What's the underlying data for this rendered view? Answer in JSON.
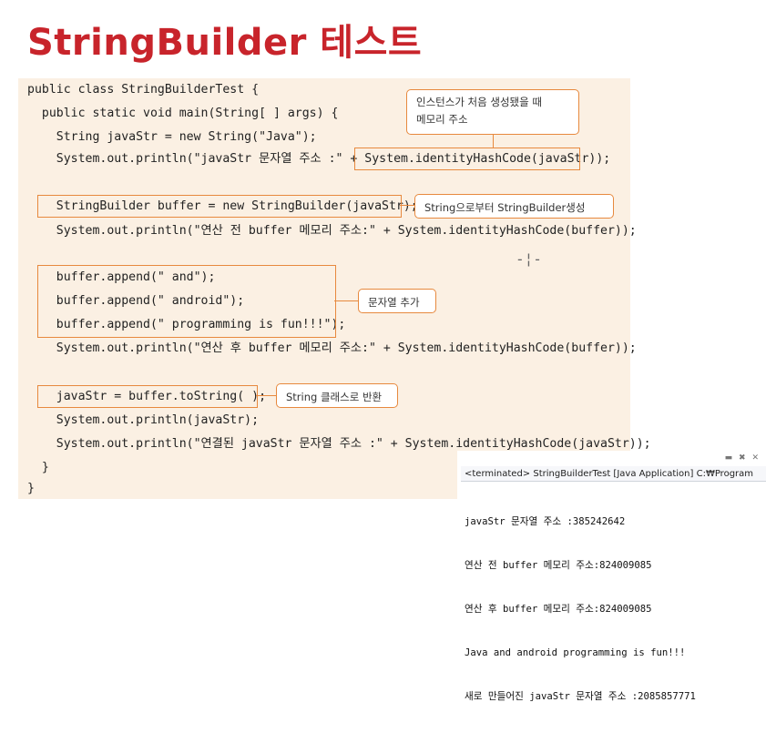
{
  "title": "StringBuilder 테스트",
  "code": {
    "line1": "public class StringBuilderTest {",
    "line2": "  public static void main(String[ ] args) {",
    "line3": "    String javaStr = new String(\"Java\");",
    "line4": "    System.out.println(\"javaStr 문자열 주소 :\" + System.identityHashCode(javaStr));",
    "line5": "    StringBuilder buffer = new StringBuilder(javaStr);",
    "line6": "    System.out.println(\"연산 전 buffer 메모리 주소:\" + System.identityHashCode(buffer));",
    "line7": "    buffer.append(\" and\");",
    "line8": "    buffer.append(\" android\");",
    "line9": "    buffer.append(\" programming is fun!!!\");",
    "line10": "    System.out.println(\"연산 후 buffer 메모리 주소:\" + System.identityHashCode(buffer));",
    "line11": "    javaStr = buffer.toString( );",
    "line12": "    System.out.println(javaStr);",
    "line13": "    System.out.println(\"연결된 javaStr 문자열 주소 :\" + System.identityHashCode(javaStr));",
    "line14": "  }",
    "line15": "}"
  },
  "callouts": {
    "memory_line1": "인스턴스가 처음 생성됐을 때",
    "memory_line2": "메모리 주소",
    "create_builder": "String으로부터 StringBuilder생성",
    "append_string": "문자열 추가",
    "to_string": "String 클래스로 반환"
  },
  "console": {
    "header": "<terminated> StringBuilderTest [Java Application] C:₩Program",
    "toolbar_icons": "minimize-icon, close-icon, remove-icon",
    "output": [
      "javaStr 문자열 주소 :385242642",
      "연산 전 buffer 메모리 주소:824009085",
      "연산 후 buffer 메모리 주소:824009085",
      "Java and android programming is fun!!!",
      "새로 만들어진 javaStr 문자열 주소 :2085857771"
    ]
  }
}
